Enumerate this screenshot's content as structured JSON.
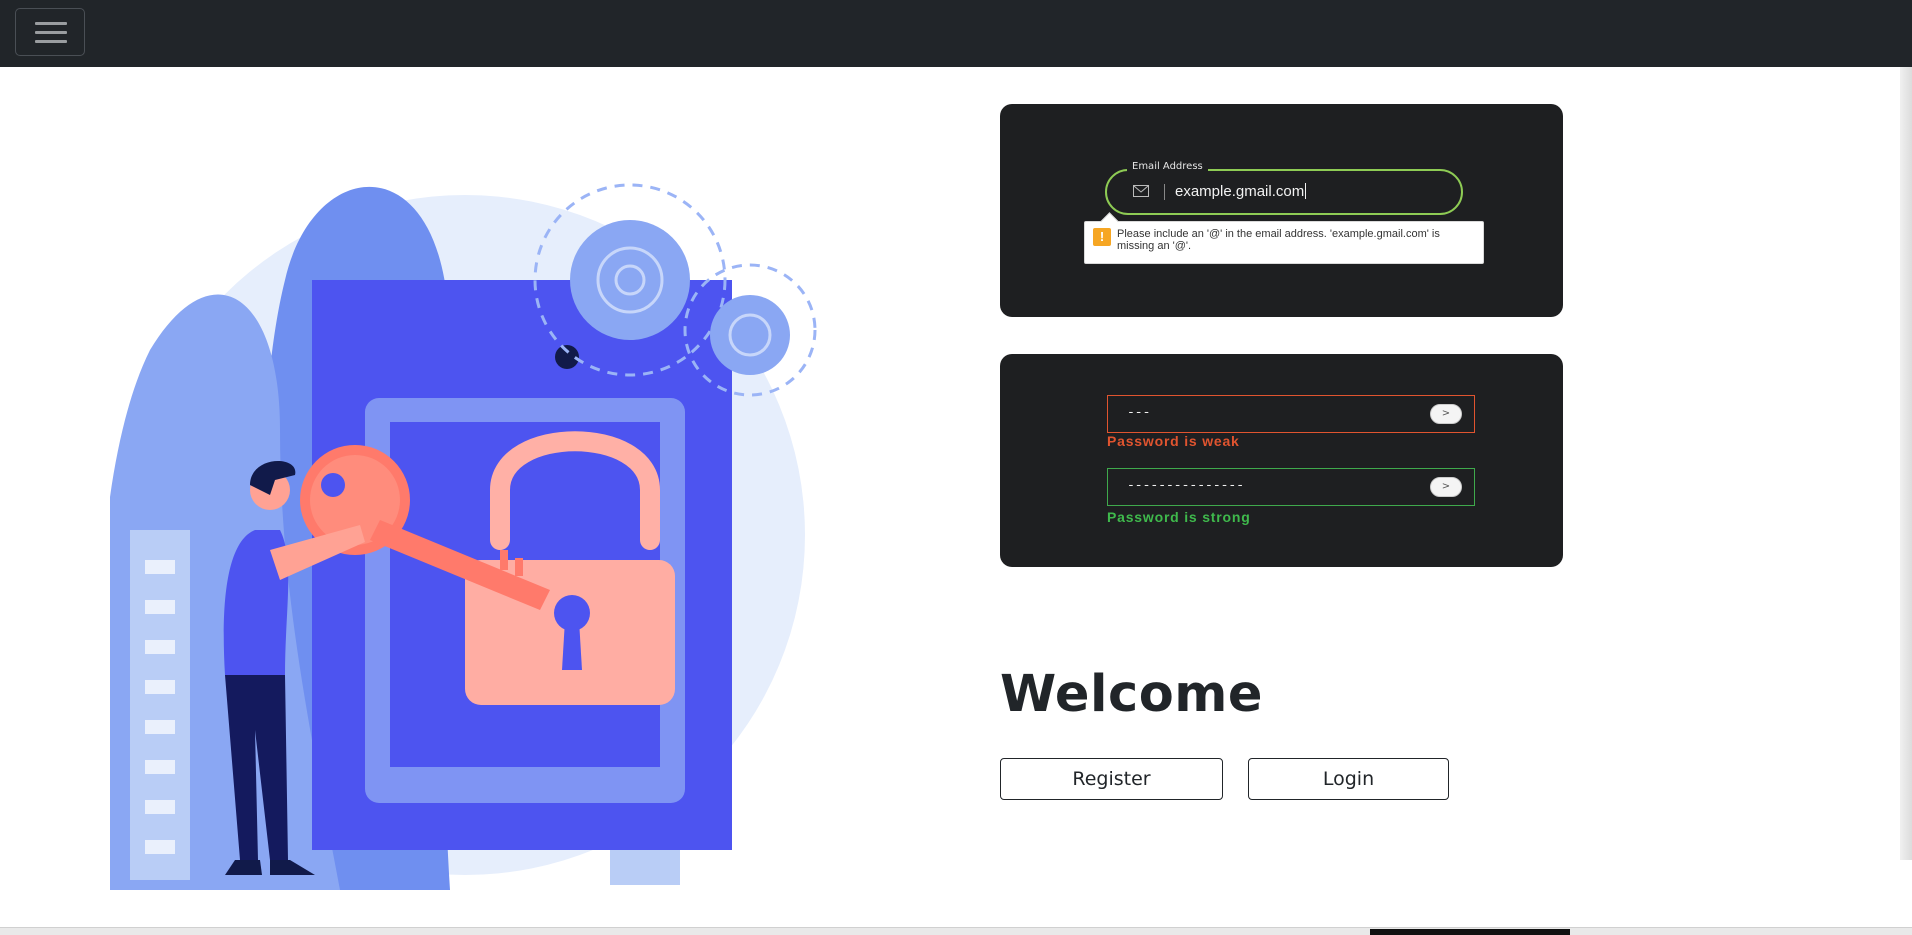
{
  "navbar": {
    "toggle_icon": "hamburger-menu-icon"
  },
  "email_card": {
    "legend": "Email Address",
    "value": "example.gmail.com",
    "tooltip_text": "Please include an '@' in the email address. 'example.gmail.com' is missing an '@'.",
    "warn_glyph": "!",
    "accent_color": "#8ecb54"
  },
  "password_card": {
    "fields": [
      {
        "value": "---",
        "button_label": ">",
        "message": "Password is weak",
        "color": "#e0542f"
      },
      {
        "value": "---------------",
        "button_label": ">",
        "message": "Password is strong",
        "color": "#3fb94c"
      }
    ]
  },
  "main": {
    "heading": "Welcome",
    "register_label": "Register",
    "login_label": "Login"
  }
}
